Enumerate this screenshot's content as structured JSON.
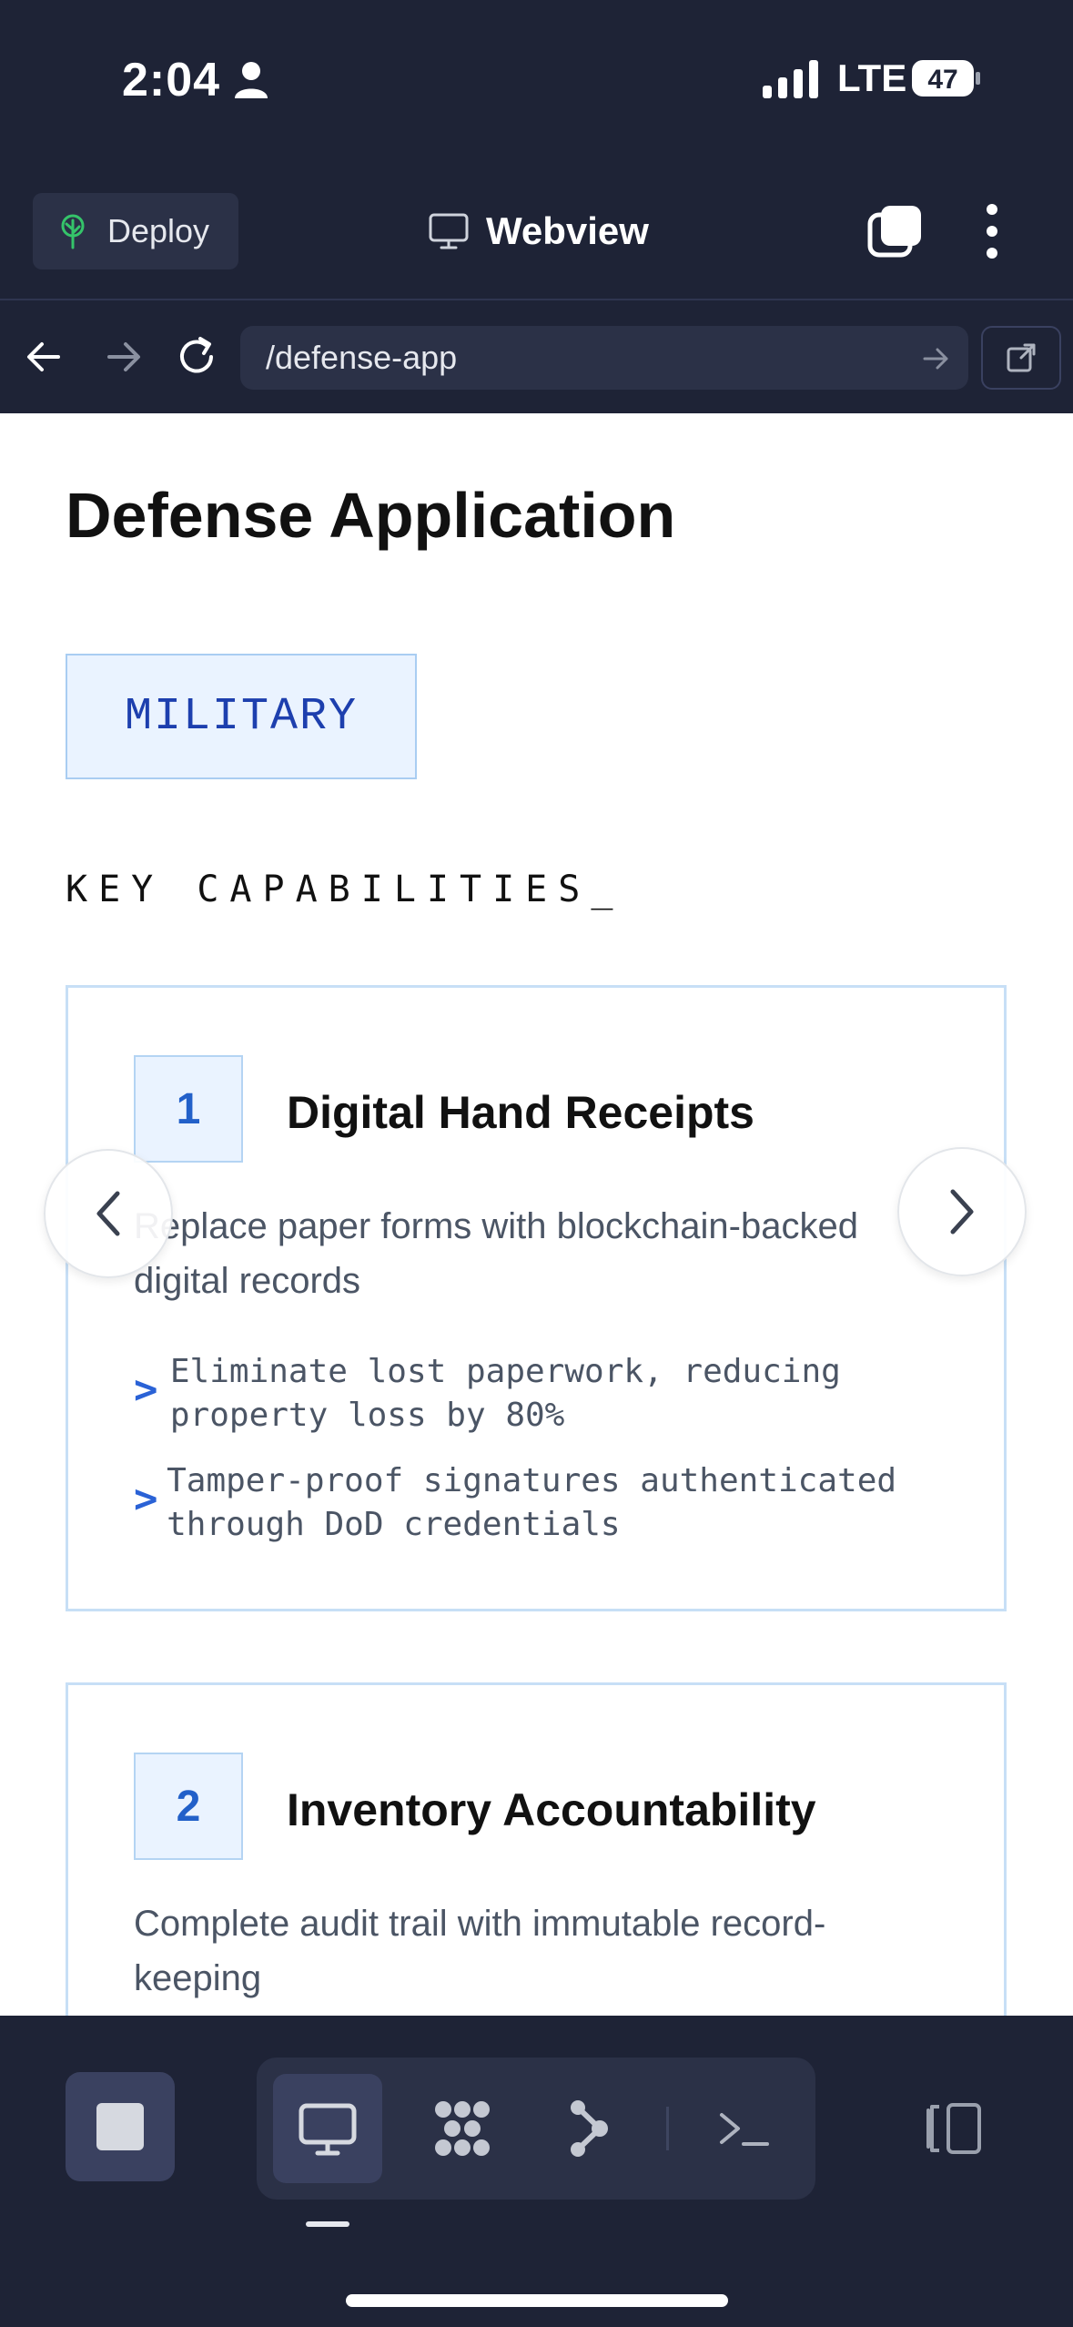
{
  "status_bar": {
    "time": "2:04",
    "network": "LTE",
    "battery": "47"
  },
  "app_header": {
    "deploy_label": "Deploy",
    "view_label": "Webview"
  },
  "url_bar": {
    "url": "/defense-app"
  },
  "page": {
    "title": "Defense Application",
    "tag": "MILITARY",
    "section_heading": "KEY CAPABILITIES_",
    "cards": [
      {
        "number": "1",
        "title": "Digital Hand Receipts",
        "description": "Replace paper forms with blockchain-backed digital records",
        "bullets": [
          {
            "marker": ">",
            "text": "Eliminate lost paperwork, reducing property loss by 80%"
          },
          {
            "marker": ">",
            "text": "Tamper-proof signatures authenticated through DoD credentials"
          }
        ]
      },
      {
        "number": "2",
        "title": "Inventory Accountability",
        "description": "Complete audit trail with immutable record-keeping"
      }
    ]
  },
  "icons": {
    "deploy": "tree-icon",
    "webview": "monitor-icon",
    "tabs": "tabs-icon",
    "menu": "kebab-menu-icon",
    "back": "arrow-left-icon",
    "forward": "arrow-right-icon",
    "reload": "reload-icon",
    "open_external": "external-link-icon",
    "prev": "chevron-left-icon",
    "next": "chevron-right-icon"
  },
  "colors": {
    "chrome_bg": "#1e2336",
    "accent_blue": "#2260c9",
    "tag_bg": "#eaf3ff",
    "deploy_green": "#35c46a"
  }
}
